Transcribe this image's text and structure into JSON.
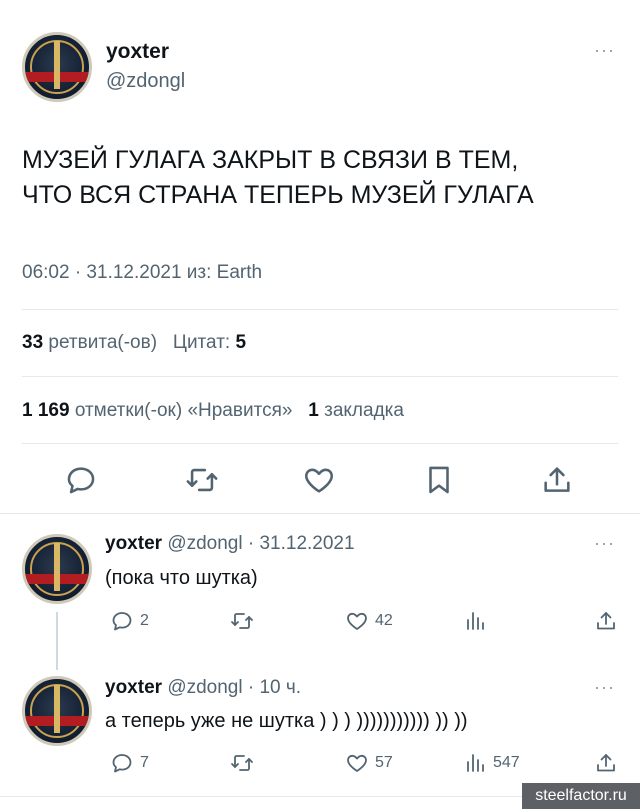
{
  "main_tweet": {
    "author_name": "yoxter",
    "author_handle": "@zdongl",
    "more_label": "···",
    "text_line1": "МУЗЕЙ ГУЛАГА ЗАКРЫТ В СВЯЗИ В ТЕМ,",
    "text_line2": "ЧТО ВСЯ СТРАНА ТЕПЕРЬ МУЗЕЙ ГУЛАГА",
    "meta": "06:02 · 31.12.2021 из: Earth",
    "retweets_count": "33",
    "retweets_label": "ретвита(-ов)",
    "quotes_label": "Цитат:",
    "quotes_count": "5",
    "likes_count": "1 169",
    "likes_label": "отметки(-ок) «Нравится»",
    "bookmarks_count": "1",
    "bookmarks_label": "закладка"
  },
  "replies": [
    {
      "author_name": "yoxter",
      "author_handle": "@zdongl · 31.12.2021",
      "text": "(пока что шутка)",
      "reply_count": "2",
      "retweet_count": "",
      "like_count": "42",
      "views_count": ""
    },
    {
      "author_name": "yoxter",
      "author_handle": "@zdongl · 10 ч.",
      "text": "а теперь уже не шутка ) ) ) ))))))))))) )) ))",
      "reply_count": "7",
      "retweet_count": "",
      "like_count": "57",
      "views_count": "547"
    }
  ],
  "icons": {
    "reply": "reply-icon",
    "retweet": "retweet-icon",
    "like": "heart-icon",
    "bookmark": "bookmark-icon",
    "share": "share-icon",
    "views": "views-icon"
  },
  "colors": {
    "text": "#0f1419",
    "secondary": "#536471",
    "divider": "#e6e9ec"
  },
  "watermark": "steelfactor.ru"
}
